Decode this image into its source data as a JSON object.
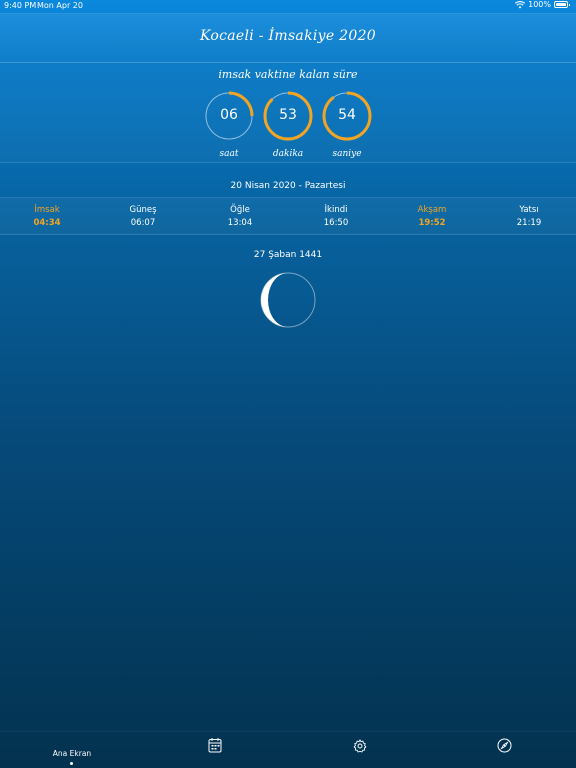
{
  "status_bar": {
    "time": "9:40 PM",
    "date": "Mon Apr 20",
    "battery": "100%"
  },
  "header": {
    "title": "Kocaeli - İmsakiye 2020"
  },
  "countdown": {
    "title": "imsak vaktine kalan süre",
    "hours": {
      "value": "06",
      "label": "saat",
      "progress": 0.25
    },
    "minutes": {
      "value": "53",
      "label": "dakika",
      "progress": 0.88
    },
    "seconds": {
      "value": "54",
      "label": "saniye",
      "progress": 0.9
    },
    "accent_color": "#f2a522"
  },
  "prayer_times": {
    "date": "20 Nisan 2020 - Pazartesi",
    "times": [
      {
        "name": "İmsak",
        "time": "04:34",
        "highlight": true
      },
      {
        "name": "Güneş",
        "time": "06:07",
        "highlight": false
      },
      {
        "name": "Öğle",
        "time": "13:04",
        "highlight": false
      },
      {
        "name": "İkindi",
        "time": "16:50",
        "highlight": false
      },
      {
        "name": "Akşam",
        "time": "19:52",
        "highlight": true
      },
      {
        "name": "Yatsı",
        "time": "21:19",
        "highlight": false
      }
    ]
  },
  "hijri": {
    "date": "27 Şaban 1441"
  },
  "tabbar": {
    "home_label": "Ana Ekran",
    "icons": [
      "calendar-icon",
      "settings-gear-icon",
      "compass-icon"
    ]
  }
}
